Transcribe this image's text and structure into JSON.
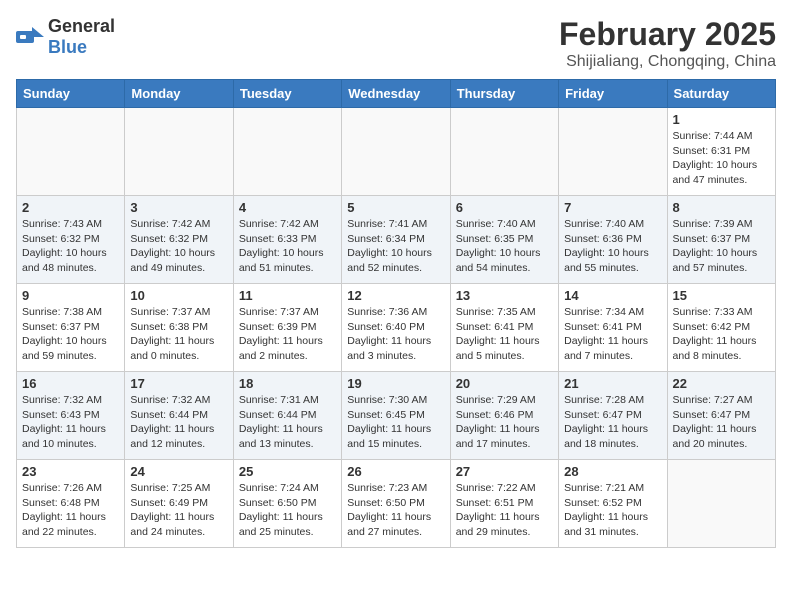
{
  "header": {
    "logo_general": "General",
    "logo_blue": "Blue",
    "month": "February 2025",
    "location": "Shijialiang, Chongqing, China"
  },
  "weekdays": [
    "Sunday",
    "Monday",
    "Tuesday",
    "Wednesday",
    "Thursday",
    "Friday",
    "Saturday"
  ],
  "weeks": [
    [
      {
        "day": "",
        "info": ""
      },
      {
        "day": "",
        "info": ""
      },
      {
        "day": "",
        "info": ""
      },
      {
        "day": "",
        "info": ""
      },
      {
        "day": "",
        "info": ""
      },
      {
        "day": "",
        "info": ""
      },
      {
        "day": "1",
        "info": "Sunrise: 7:44 AM\nSunset: 6:31 PM\nDaylight: 10 hours and 47 minutes."
      }
    ],
    [
      {
        "day": "2",
        "info": "Sunrise: 7:43 AM\nSunset: 6:32 PM\nDaylight: 10 hours and 48 minutes."
      },
      {
        "day": "3",
        "info": "Sunrise: 7:42 AM\nSunset: 6:32 PM\nDaylight: 10 hours and 49 minutes."
      },
      {
        "day": "4",
        "info": "Sunrise: 7:42 AM\nSunset: 6:33 PM\nDaylight: 10 hours and 51 minutes."
      },
      {
        "day": "5",
        "info": "Sunrise: 7:41 AM\nSunset: 6:34 PM\nDaylight: 10 hours and 52 minutes."
      },
      {
        "day": "6",
        "info": "Sunrise: 7:40 AM\nSunset: 6:35 PM\nDaylight: 10 hours and 54 minutes."
      },
      {
        "day": "7",
        "info": "Sunrise: 7:40 AM\nSunset: 6:36 PM\nDaylight: 10 hours and 55 minutes."
      },
      {
        "day": "8",
        "info": "Sunrise: 7:39 AM\nSunset: 6:37 PM\nDaylight: 10 hours and 57 minutes."
      }
    ],
    [
      {
        "day": "9",
        "info": "Sunrise: 7:38 AM\nSunset: 6:37 PM\nDaylight: 10 hours and 59 minutes."
      },
      {
        "day": "10",
        "info": "Sunrise: 7:37 AM\nSunset: 6:38 PM\nDaylight: 11 hours and 0 minutes."
      },
      {
        "day": "11",
        "info": "Sunrise: 7:37 AM\nSunset: 6:39 PM\nDaylight: 11 hours and 2 minutes."
      },
      {
        "day": "12",
        "info": "Sunrise: 7:36 AM\nSunset: 6:40 PM\nDaylight: 11 hours and 3 minutes."
      },
      {
        "day": "13",
        "info": "Sunrise: 7:35 AM\nSunset: 6:41 PM\nDaylight: 11 hours and 5 minutes."
      },
      {
        "day": "14",
        "info": "Sunrise: 7:34 AM\nSunset: 6:41 PM\nDaylight: 11 hours and 7 minutes."
      },
      {
        "day": "15",
        "info": "Sunrise: 7:33 AM\nSunset: 6:42 PM\nDaylight: 11 hours and 8 minutes."
      }
    ],
    [
      {
        "day": "16",
        "info": "Sunrise: 7:32 AM\nSunset: 6:43 PM\nDaylight: 11 hours and 10 minutes."
      },
      {
        "day": "17",
        "info": "Sunrise: 7:32 AM\nSunset: 6:44 PM\nDaylight: 11 hours and 12 minutes."
      },
      {
        "day": "18",
        "info": "Sunrise: 7:31 AM\nSunset: 6:44 PM\nDaylight: 11 hours and 13 minutes."
      },
      {
        "day": "19",
        "info": "Sunrise: 7:30 AM\nSunset: 6:45 PM\nDaylight: 11 hours and 15 minutes."
      },
      {
        "day": "20",
        "info": "Sunrise: 7:29 AM\nSunset: 6:46 PM\nDaylight: 11 hours and 17 minutes."
      },
      {
        "day": "21",
        "info": "Sunrise: 7:28 AM\nSunset: 6:47 PM\nDaylight: 11 hours and 18 minutes."
      },
      {
        "day": "22",
        "info": "Sunrise: 7:27 AM\nSunset: 6:47 PM\nDaylight: 11 hours and 20 minutes."
      }
    ],
    [
      {
        "day": "23",
        "info": "Sunrise: 7:26 AM\nSunset: 6:48 PM\nDaylight: 11 hours and 22 minutes."
      },
      {
        "day": "24",
        "info": "Sunrise: 7:25 AM\nSunset: 6:49 PM\nDaylight: 11 hours and 24 minutes."
      },
      {
        "day": "25",
        "info": "Sunrise: 7:24 AM\nSunset: 6:50 PM\nDaylight: 11 hours and 25 minutes."
      },
      {
        "day": "26",
        "info": "Sunrise: 7:23 AM\nSunset: 6:50 PM\nDaylight: 11 hours and 27 minutes."
      },
      {
        "day": "27",
        "info": "Sunrise: 7:22 AM\nSunset: 6:51 PM\nDaylight: 11 hours and 29 minutes."
      },
      {
        "day": "28",
        "info": "Sunrise: 7:21 AM\nSunset: 6:52 PM\nDaylight: 11 hours and 31 minutes."
      },
      {
        "day": "",
        "info": ""
      }
    ]
  ]
}
